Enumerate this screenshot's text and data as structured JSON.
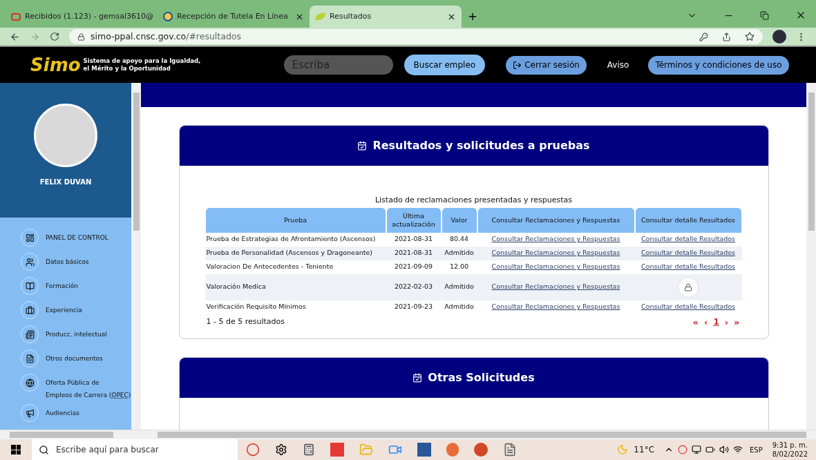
{
  "browser": {
    "tabs": [
      {
        "title": "Recibidos (1.123) - gemsal3610@",
        "kind": "mail",
        "selected": false
      },
      {
        "title": "Recepción de Tutela En Línea",
        "kind": "seal",
        "selected": false
      },
      {
        "title": "Resultados",
        "kind": "leaf",
        "selected": true
      }
    ],
    "url_host": "simo-ppal.cnsc.gov.co",
    "url_path": "/#resultados"
  },
  "header": {
    "logo_text": "Simo",
    "tagline_1": "Sistema de apoyo para la Igualdad,",
    "tagline_2": "el Mérito y la Oportunidad",
    "search": {
      "placeholder": "Escriba"
    },
    "search_button": "Buscar empleo",
    "logout_button": "Cerrar sesión",
    "notice_link": "Aviso",
    "terms_button": "Términos y condiciones de uso"
  },
  "sidebar": {
    "user_name": "FELIX DUVAN",
    "items": [
      {
        "label": "PANEL DE CONTROL"
      },
      {
        "label": "Datos básicos"
      },
      {
        "label": "Formación"
      },
      {
        "label": "Experiencia"
      },
      {
        "label": "Producc. intelectual"
      },
      {
        "label": "Otros documentos"
      },
      {
        "label": "Oferta Pública de",
        "label_2": "Empleos de Carrera (",
        "abbr": "OPEC",
        "label_3": ")"
      },
      {
        "label": "Audiencias"
      }
    ]
  },
  "results_card": {
    "title": "Resultados y solicitudes a pruebas",
    "caption": "Listado de reclamaciones presentadas y respuestas",
    "columns": [
      "Prueba",
      "Última actualización",
      "Valor",
      "Consultar Reclamaciones y Respuestas",
      "Consultar detalle Resultados"
    ],
    "rows": [
      {
        "prueba": "Prueba de Estrategias de Afrontamiento (Ascensos)",
        "fecha": "2021-08-31",
        "valor": "80.44",
        "claims_link": "Consultar Reclamaciones y Respuestas",
        "detail": {
          "kind": "link",
          "text": "Consultar detalle Resultados"
        }
      },
      {
        "prueba": "Prueba de Personalidad (Ascensos y Dragoneante)",
        "fecha": "2021-08-31",
        "valor": "Admitido",
        "claims_link": "Consultar Reclamaciones y Respuestas",
        "detail": {
          "kind": "link",
          "text": "Consultar detalle Resultados"
        }
      },
      {
        "prueba": "Valoracion De Antecedentes - Teniente",
        "fecha": "2021-09-09",
        "valor": "12.00",
        "claims_link": "Consultar Reclamaciones y Respuestas",
        "detail": {
          "kind": "link",
          "text": "Consultar detalle Resultados"
        }
      },
      {
        "prueba": "Valoración Medica",
        "fecha": "2022-02-03",
        "valor": "Admitido",
        "claims_link": "Consultar Reclamaciones y Respuestas",
        "detail": {
          "kind": "locked"
        }
      },
      {
        "prueba": "Verificación Requisito Mínimos",
        "fecha": "2021-09-23",
        "valor": "Admitido",
        "claims_link": "Consultar Reclamaciones y Respuestas",
        "detail": {
          "kind": "link",
          "text": "Consultar detalle Resultados"
        }
      }
    ],
    "summary": "1 - 5 de 5 resultados",
    "pagination": [
      {
        "label": "«",
        "selected": false
      },
      {
        "label": "‹",
        "selected": false
      },
      {
        "label": "1",
        "selected": true
      },
      {
        "label": "›",
        "selected": false
      },
      {
        "label": "»",
        "selected": false
      }
    ]
  },
  "other_card": {
    "title": "Otras Solicitudes"
  },
  "taskbar": {
    "search": {
      "placeholder": "Escribe aquí para buscar"
    },
    "temperature": "11°C",
    "language": "ESP",
    "time": "9:31 p. m.",
    "date": "8/02/2022"
  }
}
